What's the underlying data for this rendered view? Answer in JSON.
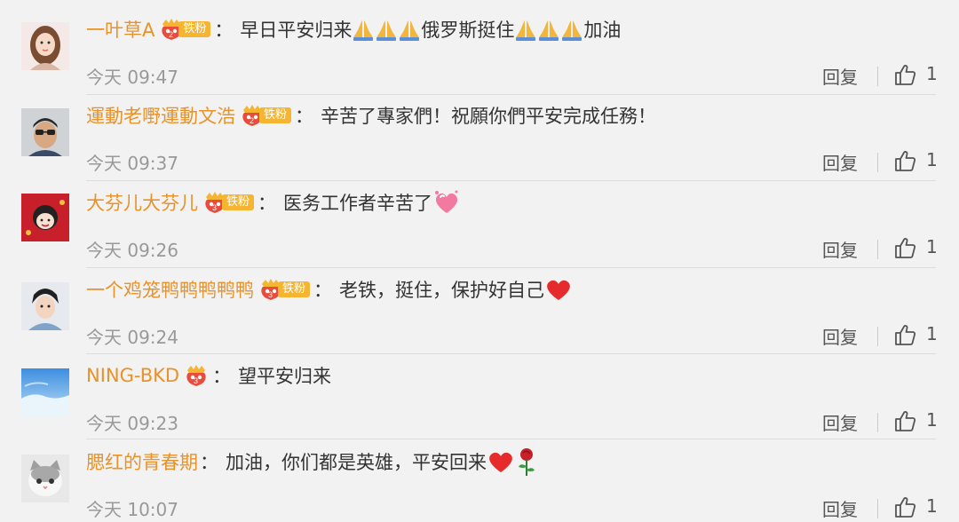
{
  "comments": [
    {
      "username": "一叶草A",
      "fan_level": "2",
      "fan_badge": "铁粉",
      "colon": "：",
      "text_parts": [
        "早日平安归来",
        "俄罗斯挺住",
        "加油"
      ],
      "emojis": [
        "pray-emoji",
        "heart-emoji"
      ],
      "time": "今天 09:47",
      "reply": "回复",
      "likes": "1"
    },
    {
      "username": "運動老嘢運動文浩",
      "fan_level": "2",
      "fan_badge": "铁粉",
      "colon": "：",
      "text": "辛苦了專家們！祝願你們平安完成任務！",
      "time": "今天 09:37",
      "reply": "回复",
      "likes": "1"
    },
    {
      "username": "大芬儿大芬儿",
      "fan_level": "3",
      "fan_badge": "铁粉",
      "colon": "：",
      "text": "医务工作者辛苦了",
      "time": "今天 09:26",
      "reply": "回复",
      "likes": "1"
    },
    {
      "username": "一个鸡笼鸭鸭鸭鸭鸭",
      "fan_level": "3",
      "fan_badge": "铁粉",
      "colon": "：",
      "text": "老铁，挺住，保护好自己",
      "time": "今天 09:24",
      "reply": "回复",
      "likes": "1"
    },
    {
      "username": "NING-BKD",
      "fan_level": "3",
      "colon": "：",
      "text": "望平安归来",
      "time": "今天 09:23",
      "reply": "回复",
      "likes": "1"
    },
    {
      "username": "腮红的青春期",
      "colon": "：",
      "text": "加油，你们都是英雄，平安回来",
      "time": "今天 10:07",
      "reply": "回复",
      "likes": "1"
    }
  ],
  "colors": {
    "username": "#e8922a",
    "badge": "#f6b531",
    "background": "#f2f2f2",
    "meta": "#999999"
  }
}
